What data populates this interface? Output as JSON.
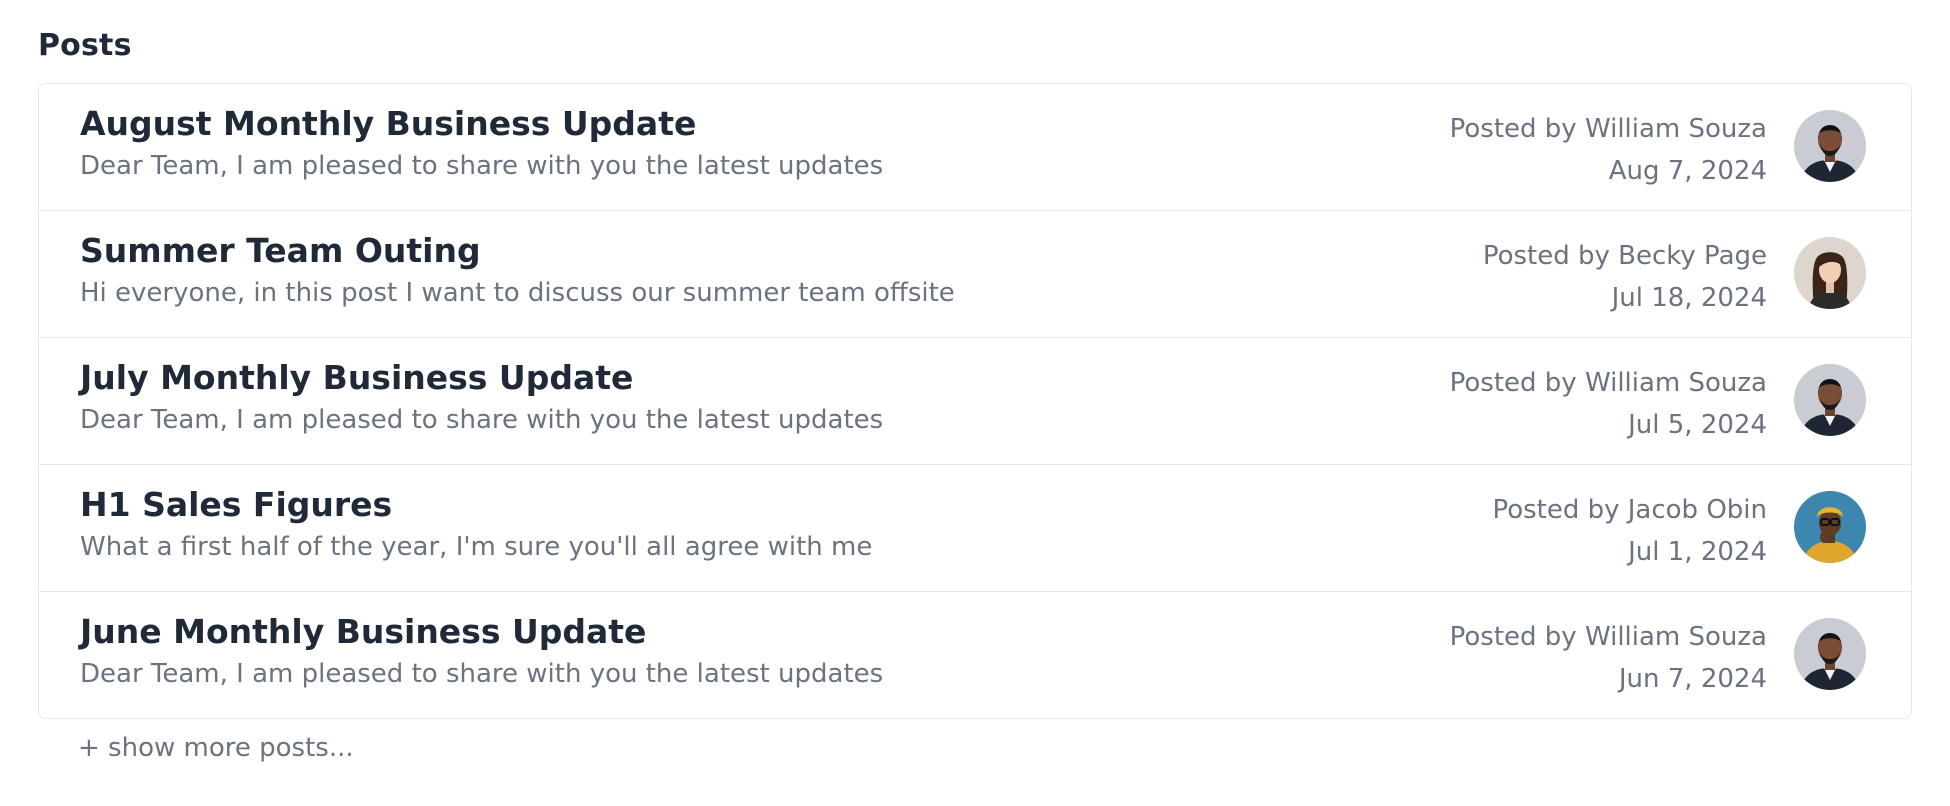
{
  "section": {
    "title": "Posts"
  },
  "posts": [
    {
      "title": "August Monthly Business Update",
      "excerpt": "Dear Team, I am pleased to share with you the latest updates",
      "author_line": "Posted by William Souza",
      "date": "Aug 7, 2024",
      "avatar": "william-souza"
    },
    {
      "title": "Summer Team Outing",
      "excerpt": "Hi everyone, in this post I want to discuss our summer team offsite",
      "author_line": "Posted by Becky Page",
      "date": "Jul 18, 2024",
      "avatar": "becky-page"
    },
    {
      "title": "July Monthly Business Update",
      "excerpt": "Dear Team, I am pleased to share with you the latest updates",
      "author_line": "Posted by William Souza",
      "date": "Jul 5, 2024",
      "avatar": "william-souza"
    },
    {
      "title": "H1 Sales Figures",
      "excerpt": "What a first half of the year, I'm sure you'll all agree with me",
      "author_line": "Posted by Jacob Obin",
      "date": "Jul 1, 2024",
      "avatar": "jacob-obin"
    },
    {
      "title": "June Monthly Business Update",
      "excerpt": "Dear Team, I am pleased to share with you the latest updates",
      "author_line": "Posted by William Souza",
      "date": "Jun 7, 2024",
      "avatar": "william-souza"
    }
  ],
  "show_more_label": "+ show more posts...",
  "colors": {
    "title": "#1f2937",
    "muted": "#6b7280",
    "border": "#e5e7eb"
  }
}
